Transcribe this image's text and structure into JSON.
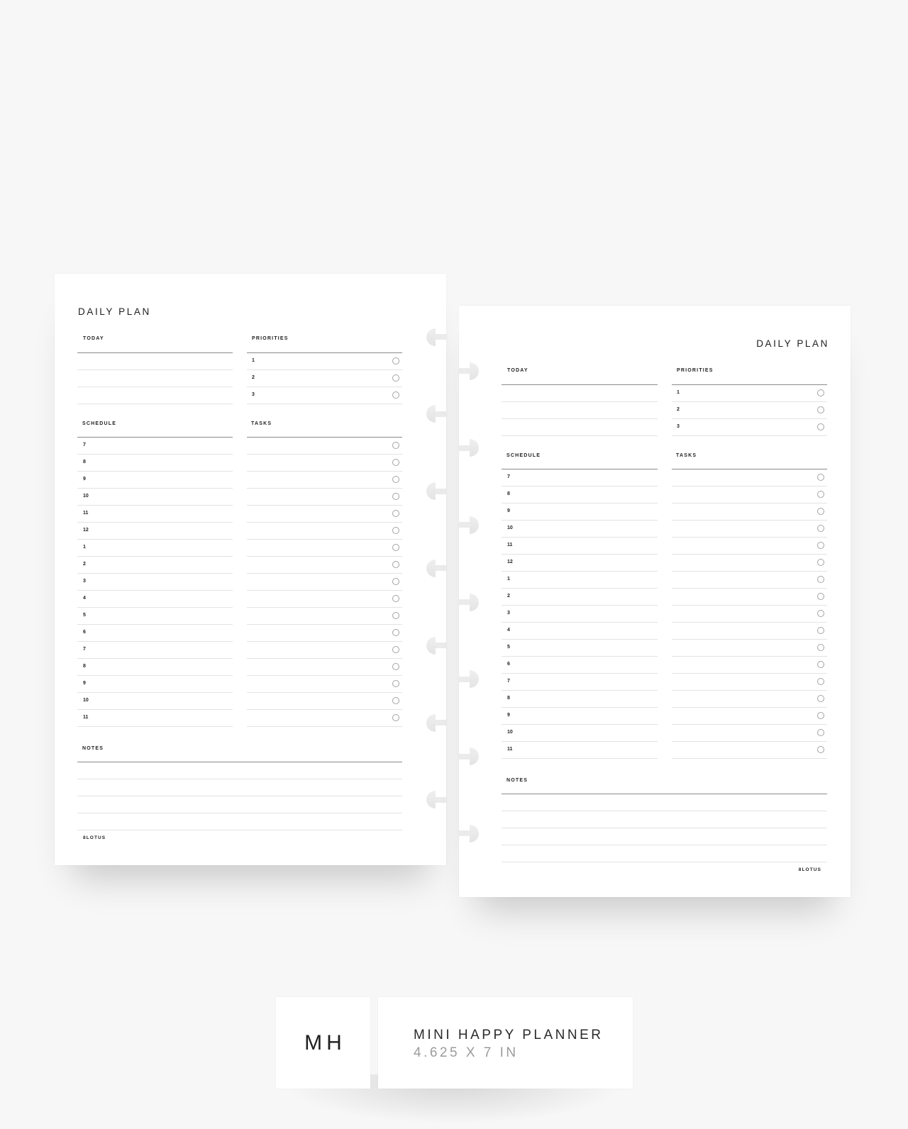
{
  "pages": [
    {
      "side": "left",
      "title": "DAILY PLAN",
      "today": {
        "label": "TODAY",
        "blank_lines": 3
      },
      "priorities": {
        "label": "PRIORITIES",
        "items": [
          "1",
          "2",
          "3"
        ],
        "checked": [
          false,
          false,
          false
        ]
      },
      "schedule": {
        "label": "SCHEDULE",
        "hours": [
          "7",
          "8",
          "9",
          "10",
          "11",
          "12",
          "1",
          "2",
          "3",
          "4",
          "5",
          "6",
          "7",
          "8",
          "9",
          "10",
          "11"
        ]
      },
      "tasks": {
        "label": "TASKS",
        "checkbox_icon": "empty-circle"
      },
      "notes": {
        "label": "NOTES",
        "blank_lines": 4
      },
      "brand": "8LOTUS",
      "disc_notches": 7
    },
    {
      "side": "right",
      "title": "DAILY PLAN",
      "today": {
        "label": "TODAY",
        "blank_lines": 3
      },
      "priorities": {
        "label": "PRIORITIES",
        "items": [
          "1",
          "2",
          "3"
        ],
        "checked": [
          false,
          false,
          false
        ]
      },
      "schedule": {
        "label": "SCHEDULE",
        "hours": [
          "7",
          "8",
          "9",
          "10",
          "11",
          "12",
          "1",
          "2",
          "3",
          "4",
          "5",
          "6",
          "7",
          "8",
          "9",
          "10",
          "11"
        ]
      },
      "tasks": {
        "label": "TASKS",
        "checkbox_icon": "empty-circle"
      },
      "notes": {
        "label": "NOTES",
        "blank_lines": 4
      },
      "brand": "8LOTUS",
      "disc_notches": 7
    }
  ],
  "size_badge": {
    "code": "MH",
    "name": "MINI HAPPY PLANNER",
    "dimensions": "4.625 X 7 IN"
  },
  "colors": {
    "background": "#f7f7f7",
    "paper": "#ffffff",
    "ink": "#222222",
    "rule_strong": "#8a8a8a",
    "rule_light": "#e3e3e3",
    "dimensions_text": "#9b9b9b"
  }
}
